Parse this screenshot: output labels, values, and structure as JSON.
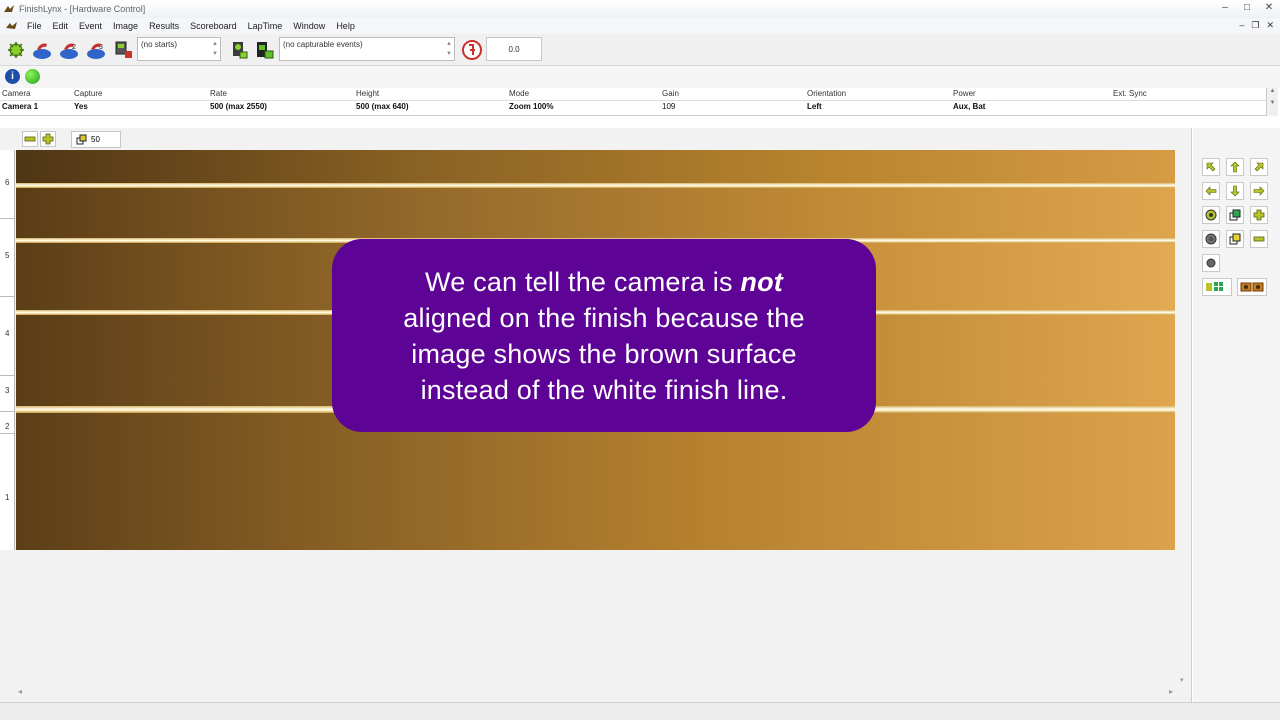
{
  "window": {
    "title": "FinishLynx - [Hardware Control]",
    "controls": [
      "–",
      "□",
      "✕"
    ]
  },
  "menu": {
    "items": [
      "File",
      "Edit",
      "Event",
      "Image",
      "Results",
      "Scoreboard",
      "LapTime",
      "Window",
      "Help"
    ],
    "mdi_controls": [
      "–",
      "❐",
      "✕"
    ]
  },
  "toolbar": {
    "starts_combo": "(no starts)",
    "events_combo": "(no capturable events)",
    "readout": "0.0"
  },
  "camera_table": {
    "headers": [
      "Camera",
      "Capture",
      "Rate",
      "Height",
      "Mode",
      "Gain",
      "Orientation",
      "Power",
      "Ext. Sync"
    ],
    "row": [
      "Camera 1",
      "Yes",
      "500  (max 2550)",
      "500  (max 640)",
      "Zoom 100%",
      "109",
      "Left",
      "Aux, Bat",
      ""
    ]
  },
  "image_toolbar": {
    "zoom_value": "50"
  },
  "ruler_labels": [
    "6",
    "5",
    "4",
    "3",
    "2",
    "1"
  ],
  "callout": {
    "line1_before": "We can tell the camera is ",
    "line1_emph": "not",
    "line2": "aligned on the finish because the",
    "line3": "image shows the brown surface",
    "line4": "instead of the white finish line."
  },
  "colors": {
    "callout_bg": "#5d0496",
    "track_dark": "#5a3f1a",
    "track_light": "#d9a24c",
    "finish_line": "#fff8dc"
  },
  "icons": {
    "toolbar": [
      "camera-hardware-icon",
      "start-sensor-icon",
      "start-sensor-2-icon",
      "start-sensor-3-icon",
      "capture-device-icon",
      "capture-toggle-icon",
      "wind-gauge-icon"
    ],
    "status": [
      "info-icon",
      "status-ok-icon"
    ],
    "image_tools": [
      "zoom-out-icon",
      "zoom-in-icon",
      "zoom-level-icon"
    ],
    "panel": [
      "pan-left-up-icon",
      "pan-up-icon",
      "pan-right-up-icon",
      "pan-left-icon",
      "pan-down-icon",
      "pan-right-icon",
      "focus-ring-icon",
      "zoom-level-icon",
      "zoom-in-icon",
      "record-icon",
      "brightness-icon",
      "zoom-out-icon",
      "settings-dot-icon",
      "grid-icon",
      "split-view-icon"
    ]
  }
}
